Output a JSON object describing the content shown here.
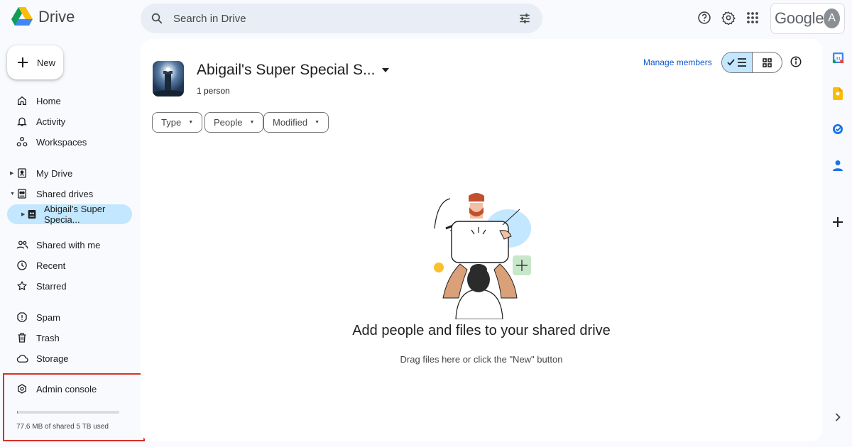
{
  "app": {
    "name": "Drive"
  },
  "search": {
    "placeholder": "Search in Drive"
  },
  "account": {
    "brand": "Google",
    "initial": "A"
  },
  "sidebar": {
    "new_label": "New",
    "items": [
      {
        "label": "Home",
        "icon": "home-icon"
      },
      {
        "label": "Activity",
        "icon": "bell-icon"
      },
      {
        "label": "Workspaces",
        "icon": "workspaces-icon"
      },
      {
        "label": "My Drive",
        "icon": "my-drive-icon"
      },
      {
        "label": "Shared drives",
        "icon": "shared-drives-icon"
      },
      {
        "label": "Abigail's Super Specia...",
        "icon": "shared-drive-icon"
      },
      {
        "label": "Shared with me",
        "icon": "people-icon"
      },
      {
        "label": "Recent",
        "icon": "clock-icon"
      },
      {
        "label": "Starred",
        "icon": "star-icon"
      },
      {
        "label": "Spam",
        "icon": "spam-icon"
      },
      {
        "label": "Trash",
        "icon": "trash-icon"
      },
      {
        "label": "Storage",
        "icon": "cloud-icon"
      }
    ],
    "admin_console": "Admin console",
    "storage_text": "77.6 MB of shared 5 TB used"
  },
  "main": {
    "drive_title": "Abigail's Super Special S...",
    "drive_subtitle": "1 person",
    "manage_members": "Manage members",
    "filters": [
      "Type",
      "People",
      "Modified"
    ],
    "empty_title": "Add people and files to your shared drive",
    "empty_subtitle": "Drag files here or click the \"New\" button"
  },
  "colors": {
    "accent": "#0b57d0",
    "selected": "#c2e7ff",
    "highlight_box": "#d93025"
  }
}
